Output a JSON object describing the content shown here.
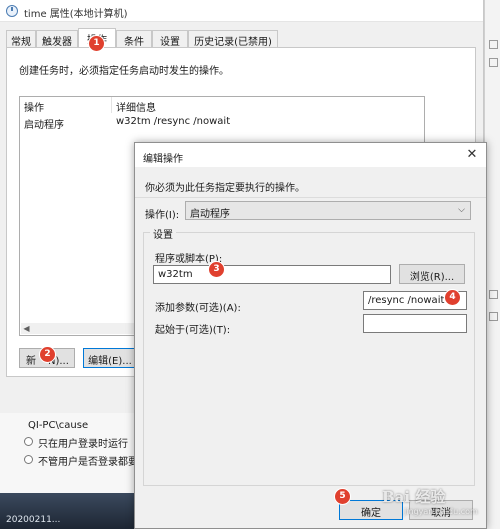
{
  "window": {
    "title": "time 属性(本地计算机)",
    "tabs": [
      "常规",
      "触发器",
      "操作",
      "条件",
      "设置",
      "历史记录(已禁用)"
    ],
    "active_tab": "操作",
    "panel_description": "创建任务时，必须指定任务启动时发生的操作。",
    "list_headers": [
      "操作",
      "详细信息"
    ],
    "list_row": {
      "action": "启动程序",
      "details": "w32tm /resync /nowait"
    },
    "new_button": "新",
    "new_button_tail": "N)...",
    "edit_button": "编辑(E)..."
  },
  "background": {
    "user": "QI-PC\\cause",
    "radio_option": "只在用户登录时运行",
    "radio_option_2": "不管用户是否登录都要",
    "desktop_text": "20200211..."
  },
  "dialog": {
    "title": "编辑操作",
    "close_glyph": "✕",
    "description": "你必须为此任务指定要执行的操作。",
    "action_label": "操作(I):",
    "action_value": "启动程序",
    "group_label": "设置",
    "program_label": "程序或脚本(P):",
    "program_value": "w32tm",
    "browse_button": "浏览(R)...",
    "args_label": "添加参数(可选)(A):",
    "args_value": "/resync /nowait",
    "start_in_label": "起始于(可选)(T):",
    "start_in_value": "",
    "ok_button": "确定",
    "cancel_button": "取消"
  },
  "markers": [
    "1",
    "2",
    "3",
    "4",
    "5"
  ],
  "watermark": {
    "text": "Bai 经验",
    "sub": "jingyan.baidu.com"
  },
  "colors": {
    "marker": "#e0402e",
    "focus_border": "#0078d7"
  }
}
